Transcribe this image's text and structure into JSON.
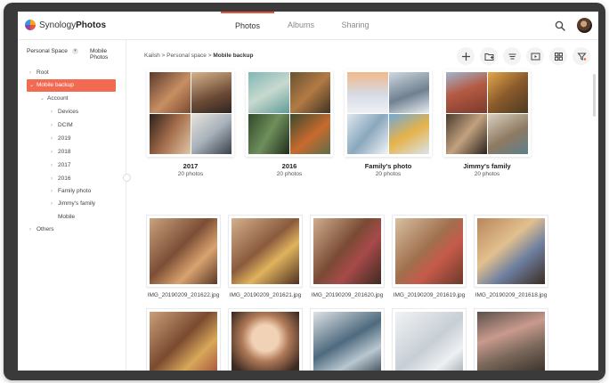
{
  "app": {
    "brand_prefix": "Synology",
    "brand_suffix": "Photos"
  },
  "top_tabs": [
    {
      "label": "Photos",
      "active": true
    },
    {
      "label": "Albums",
      "active": false
    },
    {
      "label": "Sharing",
      "active": false
    }
  ],
  "sidebar": {
    "space_label": "Personal Space",
    "switch_label": "Mobile Photos",
    "tree": [
      {
        "label": "Root",
        "expanded": false
      },
      {
        "label": "Mobile backup",
        "expanded": true,
        "selected": true
      },
      {
        "label": "Account",
        "expanded": true
      },
      {
        "label": "Devices"
      },
      {
        "label": "DCIM"
      },
      {
        "label": "2019"
      },
      {
        "label": "2018"
      },
      {
        "label": "2017"
      },
      {
        "label": "2016"
      },
      {
        "label": "Family photo"
      },
      {
        "label": "Jimmy's family"
      },
      {
        "label": "Mobile"
      },
      {
        "label": "Others"
      }
    ]
  },
  "breadcrumb": {
    "path": "Kailsh > Personal space > ",
    "current": "Mobile backup"
  },
  "toolbar_icons": [
    "add-icon",
    "new-folder-icon",
    "sort-icon",
    "slideshow-icon",
    "grid-view-icon",
    "filter-icon"
  ],
  "albums": [
    {
      "title": "2017",
      "count": "20 photos"
    },
    {
      "title": "2016",
      "count": "20 photos"
    },
    {
      "title": "Family's photo",
      "count": "20 photos"
    },
    {
      "title": "Jimmy's family",
      "count": "20 photos"
    }
  ],
  "photos_row1": [
    {
      "caption": "IMG_20190209_201622.jpg"
    },
    {
      "caption": "IMG_20190209_201621.jpg"
    },
    {
      "caption": "IMG_20190209_201620.jpg"
    },
    {
      "caption": "IMG_20190209_201619.jpg"
    },
    {
      "caption": "IMG_20190209_201618.jpg"
    }
  ],
  "photos_row2": [
    {
      "caption": ""
    },
    {
      "caption": ""
    },
    {
      "caption": ""
    },
    {
      "caption": ""
    },
    {
      "caption": ""
    }
  ],
  "colors": {
    "accent": "#f26a51",
    "active_tab_line": "#e8553a"
  }
}
